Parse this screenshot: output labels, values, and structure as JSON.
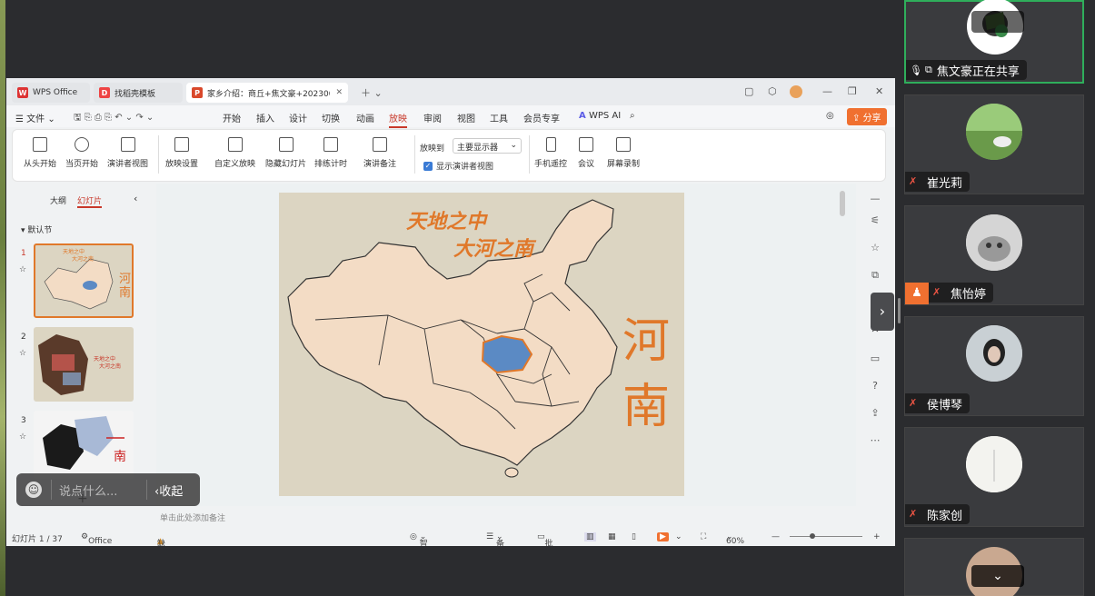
{
  "tabs": [
    {
      "label": "WPS Office"
    },
    {
      "label": "找稻壳模板"
    },
    {
      "label": "家乡介绍：商丘+焦文豪+202300"
    }
  ],
  "menu": {
    "file": "文件",
    "items": [
      "开始",
      "插入",
      "设计",
      "切换",
      "动画",
      "放映",
      "审阅",
      "视图",
      "工具",
      "会员专享"
    ],
    "active": "放映",
    "wps_ai": "WPS AI",
    "share": "分享"
  },
  "ribbon": {
    "buttons": [
      "从头开始",
      "当页开始",
      "演讲者视图",
      "放映设置",
      "自定义放映",
      "隐藏幻灯片",
      "排练计时",
      "演讲备注"
    ],
    "show_to_label": "放映到",
    "show_to_value": "主要显示器",
    "presenter_checkbox": "显示演讲者视图",
    "right_buttons": [
      "手机遥控",
      "会议",
      "屏幕录制"
    ]
  },
  "left_pane": {
    "tab_outline": "大纲",
    "tab_slides": "幻灯片",
    "section": "默认节",
    "slide_numbers": [
      "1",
      "2",
      "3"
    ]
  },
  "slide": {
    "title_line1": "天地之中",
    "title_line2": "大河之南",
    "vertical_text": "河南"
  },
  "thumb1": {
    "line1": "天地之中",
    "line2": "大河之南",
    "vertical": "河南"
  },
  "thumb2": {
    "line1": "天地之中",
    "line2": "大河之南"
  },
  "notes_placeholder": "单击此处添加备注",
  "status": {
    "slide_count": "幻灯片 1 / 37",
    "theme": "Office 主题",
    "missing_font": "缺失字体",
    "smart": "智能美化",
    "notes": "备注",
    "comments": "批注",
    "zoom": "60%"
  },
  "chat": {
    "placeholder": "说点什么...",
    "collapse": "收起"
  },
  "participants": [
    {
      "name": "焦文豪正在共享",
      "sharing": true
    },
    {
      "name": "崔光莉"
    },
    {
      "name": "焦怡婷"
    },
    {
      "name": "侯博琴"
    },
    {
      "name": "陈家创"
    }
  ],
  "colors": {
    "accent": "#c8382a",
    "slide_orange": "#e0782a",
    "map_fill": "#f3dcc5",
    "henan_blue": "#5b8ac4",
    "share_green": "#2fae5b"
  }
}
